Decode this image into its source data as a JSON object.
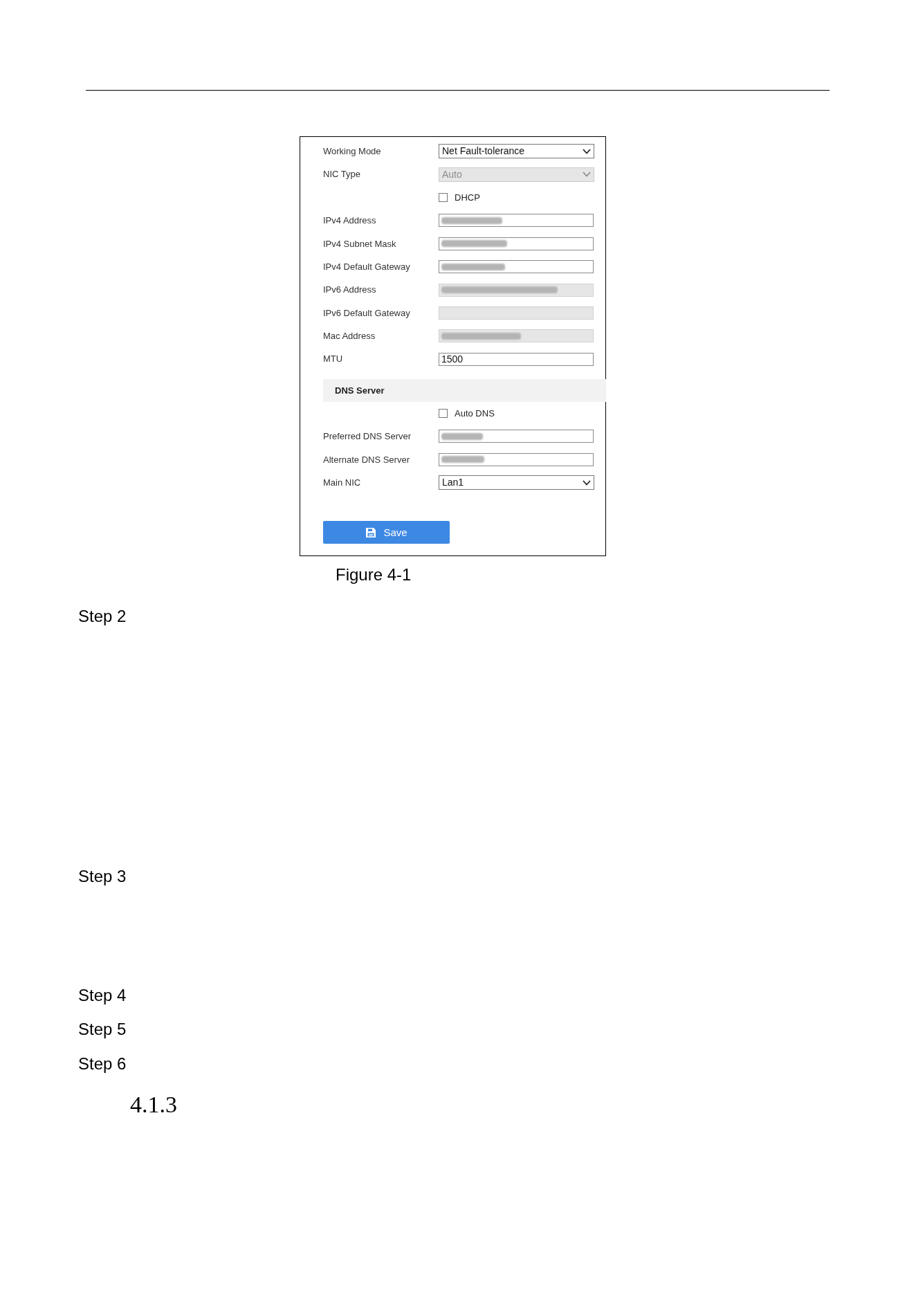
{
  "figure": {
    "form": {
      "fields": [
        {
          "label": "Working Mode",
          "kind": "select",
          "value": "Net Fault-tolerance",
          "disabled": false
        },
        {
          "label": "NIC Type",
          "kind": "select",
          "value": "Auto",
          "disabled": true
        },
        {
          "label": "DHCP",
          "kind": "checkbox",
          "checked": false
        },
        {
          "label": "IPv4 Address",
          "kind": "text",
          "disabled": false,
          "redacted": true
        },
        {
          "label": "IPv4 Subnet Mask",
          "kind": "text",
          "disabled": false,
          "redacted": true
        },
        {
          "label": "IPv4 Default Gateway",
          "kind": "text",
          "disabled": false,
          "redacted": true
        },
        {
          "label": "IPv6 Address",
          "kind": "text",
          "disabled": true,
          "redacted": true
        },
        {
          "label": "IPv6 Default Gateway",
          "kind": "text",
          "disabled": true,
          "redacted": false
        },
        {
          "label": "Mac Address",
          "kind": "text",
          "disabled": true,
          "redacted": true
        },
        {
          "label": "MTU",
          "kind": "text",
          "value": "1500",
          "disabled": false,
          "redacted": false
        }
      ],
      "dns_section": {
        "title": "DNS Server",
        "fields": [
          {
            "label": "Auto DNS",
            "kind": "checkbox",
            "checked": false
          },
          {
            "label": "Preferred DNS Server",
            "kind": "text",
            "disabled": false,
            "redacted": true
          },
          {
            "label": "Alternate DNS Server",
            "kind": "text",
            "disabled": false,
            "redacted": true
          },
          {
            "label": "Main NIC",
            "kind": "select",
            "value": "Lan1",
            "disabled": false
          }
        ]
      },
      "save_button": {
        "label": "Save"
      }
    },
    "caption": "Figure 4-1"
  },
  "steps": [
    "Step 2",
    "Step 3",
    "Step 4",
    "Step 5",
    "Step 6"
  ],
  "section_heading": "4.1.3"
}
